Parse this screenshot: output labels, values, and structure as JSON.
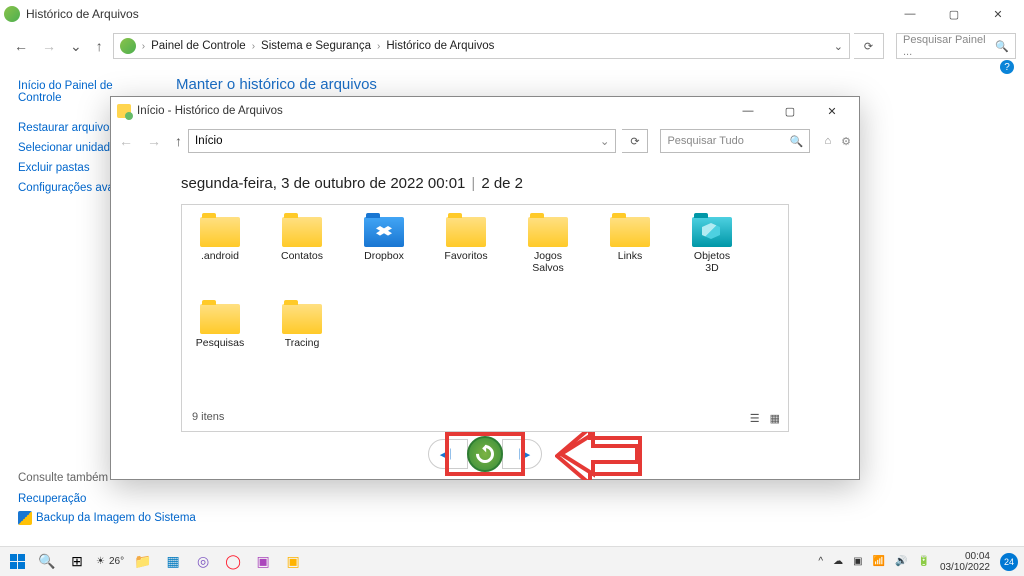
{
  "main_window": {
    "title": "Histórico de Arquivos",
    "breadcrumbs": [
      "Painel de Controle",
      "Sistema e Segurança",
      "Histórico de Arquivos"
    ],
    "search_placeholder": "Pesquisar Painel ..."
  },
  "sidebar": {
    "home_link": "Início do Painel de Controle",
    "links": [
      "Restaurar arquivos p",
      "Selecionar unidade",
      "Excluir pastas",
      "Configurações avanç"
    ]
  },
  "main_heading": "Manter o histórico de arquivos",
  "see_also": {
    "title": "Consulte também",
    "links": [
      "Recuperação",
      "Backup da Imagem do Sistema"
    ]
  },
  "fh_window": {
    "title": "Início - Histórico de Arquivos",
    "address": "Início",
    "search_placeholder": "Pesquisar Tudo",
    "date_line": "segunda-feira, 3 de outubro de 2022 00:01",
    "page_indicator": "2 de 2",
    "item_count_label": "9 itens",
    "folders": [
      {
        "name": ".android",
        "type": "folder"
      },
      {
        "name": "Contatos",
        "type": "folder"
      },
      {
        "name": "Dropbox",
        "type": "dropbox"
      },
      {
        "name": "Favoritos",
        "type": "folder"
      },
      {
        "name": "Jogos Salvos",
        "type": "folder"
      },
      {
        "name": "Links",
        "type": "folder"
      },
      {
        "name": "Objetos 3D",
        "type": "objects3d"
      },
      {
        "name": "Pesquisas",
        "type": "folder"
      },
      {
        "name": "Tracing",
        "type": "folder"
      }
    ]
  },
  "taskbar": {
    "weather_temp": "26°",
    "time": "00:04",
    "date": "03/10/2022",
    "notif_count": "24"
  }
}
